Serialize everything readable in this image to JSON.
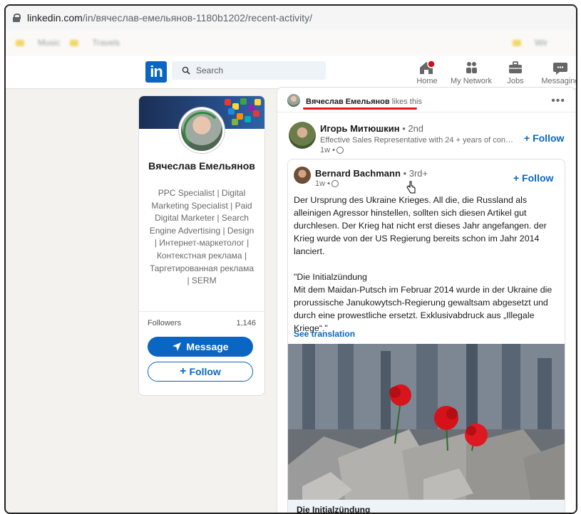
{
  "browser": {
    "url_host": "linkedin.com",
    "url_path": "/in/вячеслав-емельянов-1180b1202/recent-activity/",
    "bookmarks": [
      "Music",
      "Travels"
    ],
    "bookmark_right": "Wir"
  },
  "nav": {
    "logo": "in",
    "search_placeholder": "Search",
    "items": [
      {
        "label": "Home",
        "icon": "home-icon"
      },
      {
        "label": "My Network",
        "icon": "network-icon"
      },
      {
        "label": "Jobs",
        "icon": "briefcase-icon"
      },
      {
        "label": "Messaging",
        "icon": "messaging-icon"
      }
    ]
  },
  "profile": {
    "name": "Вячеслав Емельянов",
    "headline": "PPC Specialist | Digital Marketing Specialist | Paid Digital Marketer | Search Engine Advertising | Design | Интернет-маркетолог | Контекстная реклама | Таргетированная реклама | SERM",
    "followers_label": "Followers",
    "followers_count": "1,146",
    "message_label": "Message",
    "follow_label": "Follow"
  },
  "activity": {
    "liker_name": "Вячеслав Емельянов",
    "like_action": "likes this",
    "more_label": "•••"
  },
  "post": {
    "author_name": "Игорь Митюшкин",
    "author_degree": "• 2nd",
    "author_headline": "Effective Sales Representative with 24 + years of conside...",
    "time": "1w •",
    "follow_label": "Follow"
  },
  "shared": {
    "author_name": "Bernard Bachmann",
    "author_degree": "• 3rd+",
    "time": "1w •",
    "follow_label": "Follow",
    "paragraph1": "Der Ursprung des Ukraine Krieges. All die, die Russland als alleinigen Agressor hinstellen, sollten sich diesen Artikel gut durchlesen. Der Krieg hat nicht erst dieses Jahr angefangen. der Krieg wurde von der US Regierung bereits schon im Jahr 2014 lanciert.",
    "paragraph2_title": "\"Die Initialzündung",
    "paragraph2": "Mit dem Maidan-Putsch im Februar 2014 wurde in der Ukraine die prorussische Janukowytsch-Regierung gewaltsam abgesetzt und durch eine prowestliche ersetzt. Exklusivabdruck aus „Illegale Kriege“.\"",
    "see_translation": "See translation",
    "article_title": "Die Initialzündung"
  },
  "colors": {
    "linkedin_blue": "#0a66c2",
    "page_bg": "#f3f2ef",
    "highlight_red": "#e0191b",
    "notification_red": "#cc1016"
  }
}
